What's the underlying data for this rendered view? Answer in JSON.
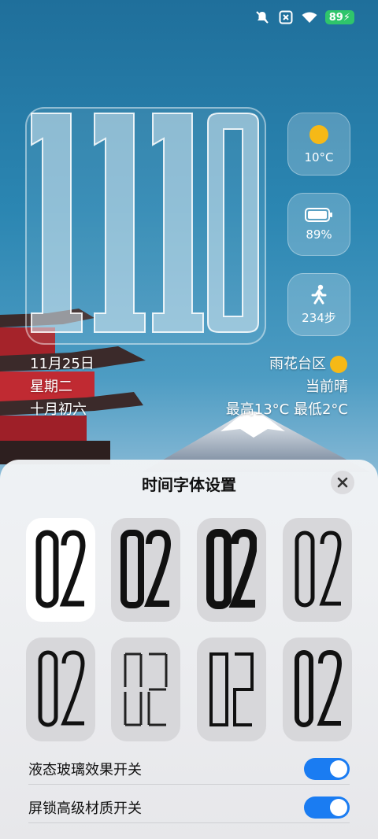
{
  "status": {
    "battery": "89"
  },
  "clock": {
    "time": "1110"
  },
  "widgets": {
    "weather": {
      "value": "10°C"
    },
    "battery": {
      "value": "89%"
    },
    "steps": {
      "value": "234步"
    }
  },
  "info": {
    "date": "11月25日",
    "weekday": "星期二",
    "lunar": "十月初六",
    "location": "雨花台区",
    "condition": "当前晴",
    "temp_range": "最高13°C 最低2°C"
  },
  "sheet": {
    "title": "时间字体设置",
    "sample": "02",
    "toggles": [
      {
        "label": "液态玻璃效果开关",
        "on": true
      },
      {
        "label": "屏锁高级材质开关",
        "on": true
      }
    ]
  },
  "colors": {
    "accent": "#1a7cf2",
    "sun": "#f6b917",
    "battery_green": "#2fc56b"
  }
}
